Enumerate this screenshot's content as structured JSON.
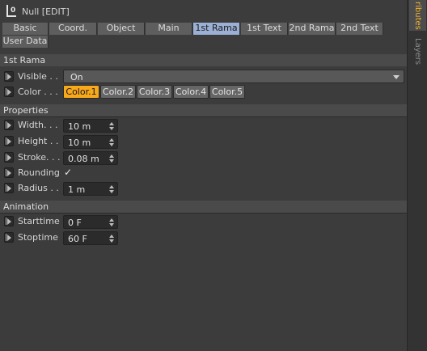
{
  "title": "Null [EDIT]",
  "tabs": [
    {
      "label": "Basic"
    },
    {
      "label": "Coord."
    },
    {
      "label": "Object"
    },
    {
      "label": "Main"
    },
    {
      "label": "1st Rama",
      "active": true
    },
    {
      "label": "1st Text"
    },
    {
      "label": "2nd Rama"
    },
    {
      "label": "2nd Text"
    },
    {
      "label": "User Data"
    }
  ],
  "sections": {
    "rama": "1st Rama",
    "properties": "Properties",
    "animation": "Animation"
  },
  "rama": {
    "visible": {
      "label": "Visible . .",
      "value": "On"
    },
    "color": {
      "label": "Color . . .",
      "options": [
        "Color.1",
        "Color.2",
        "Color.3",
        "Color.4",
        "Color.5"
      ],
      "selected": "Color.1"
    }
  },
  "properties": {
    "width": {
      "label": "Width. . .",
      "value": "10 m"
    },
    "height": {
      "label": "Height . .",
      "value": "10 m"
    },
    "stroke": {
      "label": "Stroke. . .",
      "value": "0.08 m"
    },
    "rounding": {
      "label": "Rounding",
      "checked": true,
      "check_glyph": "✓"
    },
    "radius": {
      "label": "Radius . .",
      "value": "1 m"
    }
  },
  "animation": {
    "starttime": {
      "label": "Starttime",
      "value": "0 F"
    },
    "stoptime": {
      "label": "Stoptime",
      "value": "60 F"
    }
  },
  "sidebar": {
    "tabs": [
      {
        "label": "ributes",
        "active": true
      },
      {
        "label": "Layers",
        "active": false
      }
    ]
  },
  "colors": {
    "active_tab": "#9bb0d4",
    "active_color_button": "#f7a81b",
    "sidebar_active_text": "#f2b134"
  }
}
